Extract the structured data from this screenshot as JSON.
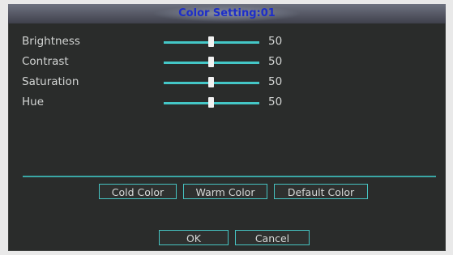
{
  "dialog": {
    "title": "Color Setting:01",
    "settings": [
      {
        "label": "Brightness",
        "value": "50",
        "level": 0.5
      },
      {
        "label": "Contrast",
        "value": "50",
        "level": 0.5
      },
      {
        "label": "Saturation",
        "value": "50",
        "level": 0.5
      },
      {
        "label": "Hue",
        "value": "50",
        "level": 0.5
      }
    ],
    "presets": {
      "cold": "Cold Color",
      "warm": "Warm Color",
      "default": "Default Color"
    },
    "actions": {
      "ok": "OK",
      "cancel": "Cancel"
    }
  },
  "colors": {
    "accent": "#44c7c7",
    "title_text": "#1d2ec9",
    "panel": "#2a2c2b"
  }
}
